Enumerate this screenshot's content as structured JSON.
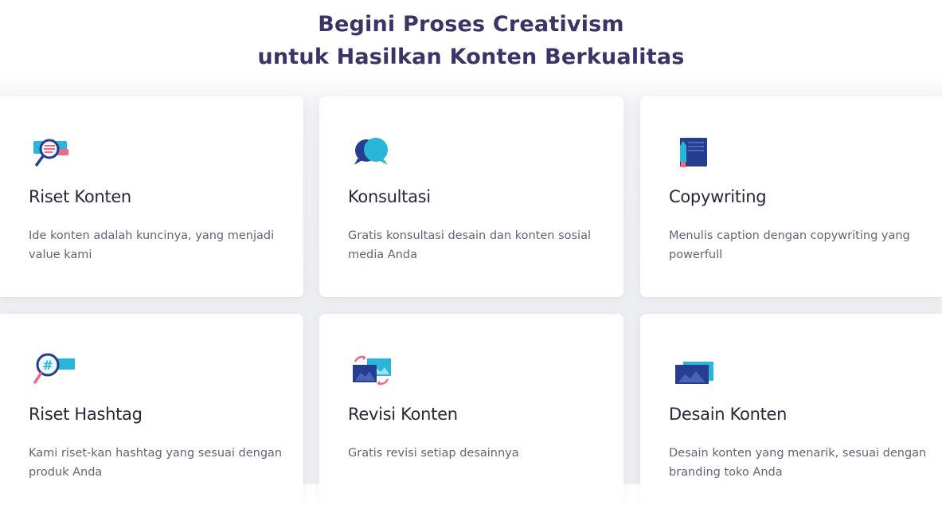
{
  "section": {
    "title_line1": "Begini Proses Creativism",
    "title_line2": "untuk Hasilkan Konten Berkualitas"
  },
  "cards": [
    {
      "icon": "research-magnifier-icon",
      "title": "Riset Konten",
      "description": "Ide konten adalah kuncinya, yang menjadi value kami"
    },
    {
      "icon": "chat-bubbles-icon",
      "title": "Konsultasi",
      "description": "Gratis konsultasi desain dan konten sosial media Anda"
    },
    {
      "icon": "notebook-pen-icon",
      "title": "Copywriting",
      "description": "Menulis caption dengan copywriting yang powerfull"
    },
    {
      "icon": "hashtag-magnifier-icon",
      "title": "Riset Hashtag",
      "description": "Kami riset-kan hashtag yang sesuai dengan produk Anda"
    },
    {
      "icon": "image-revision-icon",
      "title": "Revisi Konten",
      "description": "Gratis revisi setiap desainnya"
    },
    {
      "icon": "image-design-icon",
      "title": "Desain Konten",
      "description": "Desain konten yang menarik, sesuai dengan branding toko Anda"
    }
  ],
  "colors": {
    "heading": "#3b3467",
    "card_title": "#26283a",
    "card_text": "#616477",
    "icon_navy": "#263e8f",
    "icon_cyan": "#29b6d8",
    "icon_pink": "#ee6a8c"
  }
}
